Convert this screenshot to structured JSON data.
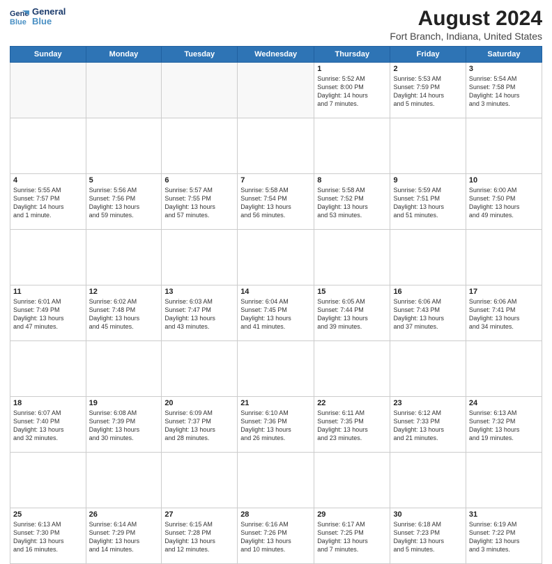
{
  "logo": {
    "line1": "General",
    "line2": "Blue"
  },
  "title": "August 2024",
  "subtitle": "Fort Branch, Indiana, United States",
  "days_of_week": [
    "Sunday",
    "Monday",
    "Tuesday",
    "Wednesday",
    "Thursday",
    "Friday",
    "Saturday"
  ],
  "weeks": [
    [
      {
        "day": "",
        "info": ""
      },
      {
        "day": "",
        "info": ""
      },
      {
        "day": "",
        "info": ""
      },
      {
        "day": "",
        "info": ""
      },
      {
        "day": "1",
        "info": "Sunrise: 5:52 AM\nSunset: 8:00 PM\nDaylight: 14 hours\nand 7 minutes."
      },
      {
        "day": "2",
        "info": "Sunrise: 5:53 AM\nSunset: 7:59 PM\nDaylight: 14 hours\nand 5 minutes."
      },
      {
        "day": "3",
        "info": "Sunrise: 5:54 AM\nSunset: 7:58 PM\nDaylight: 14 hours\nand 3 minutes."
      }
    ],
    [
      {
        "day": "4",
        "info": "Sunrise: 5:55 AM\nSunset: 7:57 PM\nDaylight: 14 hours\nand 1 minute."
      },
      {
        "day": "5",
        "info": "Sunrise: 5:56 AM\nSunset: 7:56 PM\nDaylight: 13 hours\nand 59 minutes."
      },
      {
        "day": "6",
        "info": "Sunrise: 5:57 AM\nSunset: 7:55 PM\nDaylight: 13 hours\nand 57 minutes."
      },
      {
        "day": "7",
        "info": "Sunrise: 5:58 AM\nSunset: 7:54 PM\nDaylight: 13 hours\nand 56 minutes."
      },
      {
        "day": "8",
        "info": "Sunrise: 5:58 AM\nSunset: 7:52 PM\nDaylight: 13 hours\nand 53 minutes."
      },
      {
        "day": "9",
        "info": "Sunrise: 5:59 AM\nSunset: 7:51 PM\nDaylight: 13 hours\nand 51 minutes."
      },
      {
        "day": "10",
        "info": "Sunrise: 6:00 AM\nSunset: 7:50 PM\nDaylight: 13 hours\nand 49 minutes."
      }
    ],
    [
      {
        "day": "11",
        "info": "Sunrise: 6:01 AM\nSunset: 7:49 PM\nDaylight: 13 hours\nand 47 minutes."
      },
      {
        "day": "12",
        "info": "Sunrise: 6:02 AM\nSunset: 7:48 PM\nDaylight: 13 hours\nand 45 minutes."
      },
      {
        "day": "13",
        "info": "Sunrise: 6:03 AM\nSunset: 7:47 PM\nDaylight: 13 hours\nand 43 minutes."
      },
      {
        "day": "14",
        "info": "Sunrise: 6:04 AM\nSunset: 7:45 PM\nDaylight: 13 hours\nand 41 minutes."
      },
      {
        "day": "15",
        "info": "Sunrise: 6:05 AM\nSunset: 7:44 PM\nDaylight: 13 hours\nand 39 minutes."
      },
      {
        "day": "16",
        "info": "Sunrise: 6:06 AM\nSunset: 7:43 PM\nDaylight: 13 hours\nand 37 minutes."
      },
      {
        "day": "17",
        "info": "Sunrise: 6:06 AM\nSunset: 7:41 PM\nDaylight: 13 hours\nand 34 minutes."
      }
    ],
    [
      {
        "day": "18",
        "info": "Sunrise: 6:07 AM\nSunset: 7:40 PM\nDaylight: 13 hours\nand 32 minutes."
      },
      {
        "day": "19",
        "info": "Sunrise: 6:08 AM\nSunset: 7:39 PM\nDaylight: 13 hours\nand 30 minutes."
      },
      {
        "day": "20",
        "info": "Sunrise: 6:09 AM\nSunset: 7:37 PM\nDaylight: 13 hours\nand 28 minutes."
      },
      {
        "day": "21",
        "info": "Sunrise: 6:10 AM\nSunset: 7:36 PM\nDaylight: 13 hours\nand 26 minutes."
      },
      {
        "day": "22",
        "info": "Sunrise: 6:11 AM\nSunset: 7:35 PM\nDaylight: 13 hours\nand 23 minutes."
      },
      {
        "day": "23",
        "info": "Sunrise: 6:12 AM\nSunset: 7:33 PM\nDaylight: 13 hours\nand 21 minutes."
      },
      {
        "day": "24",
        "info": "Sunrise: 6:13 AM\nSunset: 7:32 PM\nDaylight: 13 hours\nand 19 minutes."
      }
    ],
    [
      {
        "day": "25",
        "info": "Sunrise: 6:13 AM\nSunset: 7:30 PM\nDaylight: 13 hours\nand 16 minutes."
      },
      {
        "day": "26",
        "info": "Sunrise: 6:14 AM\nSunset: 7:29 PM\nDaylight: 13 hours\nand 14 minutes."
      },
      {
        "day": "27",
        "info": "Sunrise: 6:15 AM\nSunset: 7:28 PM\nDaylight: 13 hours\nand 12 minutes."
      },
      {
        "day": "28",
        "info": "Sunrise: 6:16 AM\nSunset: 7:26 PM\nDaylight: 13 hours\nand 10 minutes."
      },
      {
        "day": "29",
        "info": "Sunrise: 6:17 AM\nSunset: 7:25 PM\nDaylight: 13 hours\nand 7 minutes."
      },
      {
        "day": "30",
        "info": "Sunrise: 6:18 AM\nSunset: 7:23 PM\nDaylight: 13 hours\nand 5 minutes."
      },
      {
        "day": "31",
        "info": "Sunrise: 6:19 AM\nSunset: 7:22 PM\nDaylight: 13 hours\nand 3 minutes."
      }
    ]
  ]
}
